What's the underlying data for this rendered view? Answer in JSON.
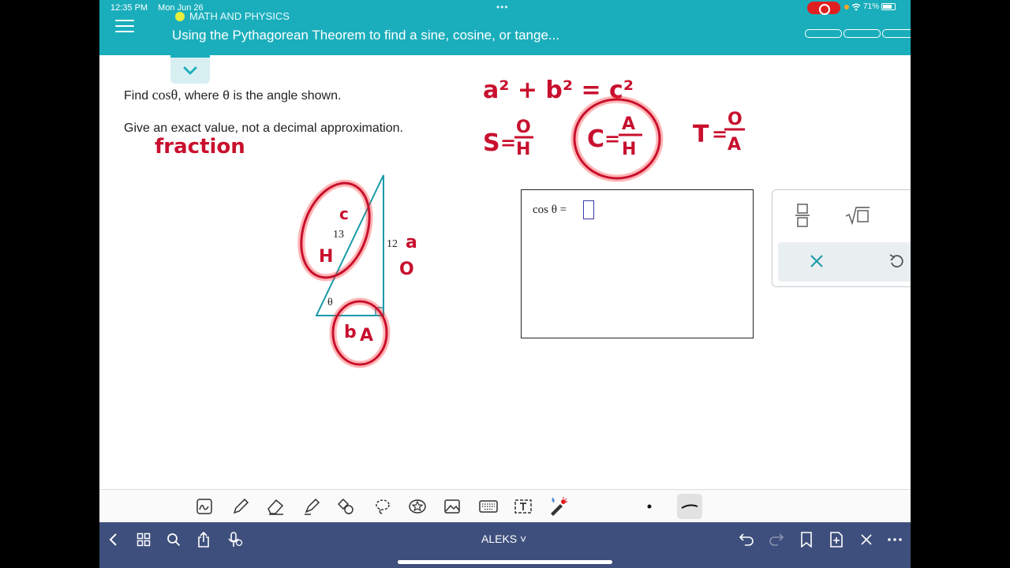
{
  "status_bar": {
    "time": "12:35 PM",
    "date": "Mon Jun 26",
    "battery": "71%"
  },
  "header": {
    "category": "MATH AND PHYSICS",
    "title": "Using the Pythagorean Theorem to find a sine, cosine, or tange..."
  },
  "question": {
    "find_prefix": "Find",
    "find_expr": "cosθ",
    "find_suffix": ", where θ is the angle shown.",
    "instruction": "Give an exact value, not a decimal approximation."
  },
  "triangle": {
    "hypotenuse": "13",
    "opposite": "12",
    "angle": "θ"
  },
  "answer": {
    "label": "cos θ  =",
    "value": ""
  },
  "annotations": {
    "fraction": "fraction",
    "pythagoras": "a² + b² = c²",
    "sine_letter": "S",
    "cosine_letter": "C",
    "tangent_letter": "T",
    "s_num": "O",
    "s_den": "H",
    "c_num": "A",
    "c_den": "H",
    "t_num": "O",
    "t_den": "A",
    "hyp_c": "c",
    "hyp_h": "H",
    "opp_a": "a",
    "opp_o": "O",
    "adj_b": "b",
    "adj_a": "A"
  },
  "bottom_bar": {
    "app_name": "ALEKS ˅"
  },
  "colors": {
    "header": "#1aaebc",
    "accent": "#1aaebc",
    "ink": "#c8102e",
    "bottom_bar": "#3e4f7d"
  }
}
